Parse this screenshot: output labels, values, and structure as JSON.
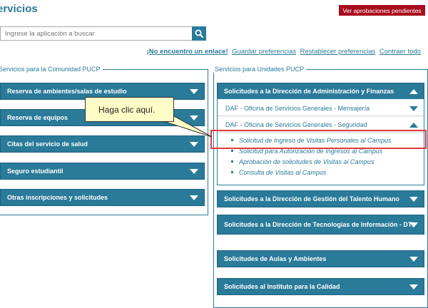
{
  "header": {
    "title": "ervicios",
    "pending_button": "Ver aprobaciones pendientes"
  },
  "search": {
    "placeholder": "Ingrese la aplicación a buscar",
    "icon": "search-icon"
  },
  "links": {
    "not_found": "¡No encuentro un enlace!",
    "save": "Guardar preferencias",
    "reset": "Restablecer preferencias",
    "collapse": "Contraer todo"
  },
  "left_panel": {
    "legend": "Servicios para la Comunidad PUCP",
    "items": [
      "Reserva de ambientes/salas de estudio",
      "Reserva de equipos",
      "Citas del servicio de salud",
      "Seguro estudiantil",
      "Otras inscripciones y solicitudes"
    ]
  },
  "right_panel": {
    "legend": "Servicios para Unidades PUCP",
    "open_item": "Solicitudes a la Dirección de Administración y Finanzas",
    "sub_items": [
      "DAF - Oficina de Servicios Generales - Mensajería",
      "DAF - Oficina de Servicios Generales - Seguridad"
    ],
    "links": [
      "Solicitud de Ingreso de Visitas Personales al Campus",
      "Solicitud para Autorización de Ingresos al Campus",
      "Aprobación de solicitudes de Visitas al Campus",
      "Consulta de Visitas al Campus"
    ],
    "items": [
      "Solicitudes a la Dirección de Gestión del Talento Humano",
      "Solicitudes a la Dirección de Tecnologías de Información - DTI",
      "Solicitudes de Aulas y Ambientes",
      "Solicitudes al Instituto para la Calidad"
    ]
  },
  "tooltip": {
    "text": "Haga clic aquí."
  },
  "colors": {
    "accent": "#2a7a99",
    "pending": "#a80d1d",
    "highlight": "#e03a3a",
    "tooltip_bg": "#fffdc7"
  }
}
